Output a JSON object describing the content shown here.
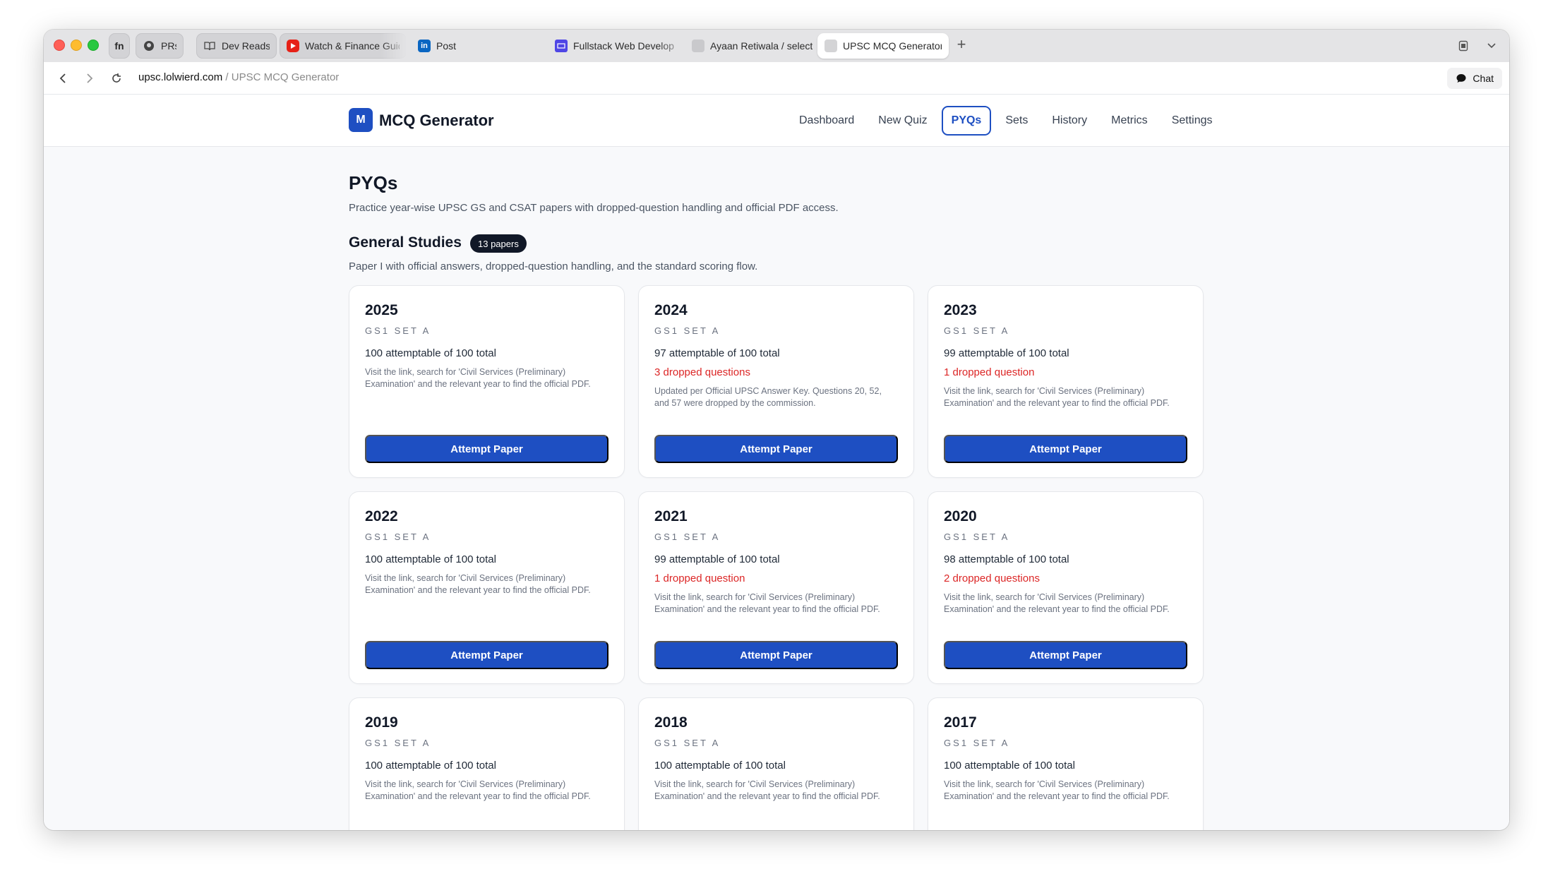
{
  "browser": {
    "tabs": [
      {
        "label": "fn",
        "icon": "fn-badge",
        "pinned": true
      },
      {
        "label": "PRs",
        "icon": "github-icon",
        "pinned": true
      },
      {
        "label": "Dev Reads",
        "icon": "book-icon",
        "pinned": true
      },
      {
        "label": "Watch & Finance Guid",
        "icon": "youtube-icon",
        "pinned": true
      },
      {
        "label": "Post",
        "icon": "linkedin-icon"
      },
      {
        "label": "Fullstack Web Develop",
        "icon": "course-icon"
      },
      {
        "label": "Ayaan Retiwala / select",
        "icon": "page-icon"
      },
      {
        "label": "UPSC MCQ Generator",
        "icon": "page-icon",
        "active": true
      }
    ],
    "url": {
      "domain": "upsc.lolwierd.com",
      "separator": " / ",
      "page": "UPSC MCQ Generator"
    },
    "chat_label": "Chat"
  },
  "app": {
    "logo_letter": "M",
    "brand": "MCQ Generator",
    "nav": [
      "Dashboard",
      "New Quiz",
      "PYQs",
      "Sets",
      "History",
      "Metrics",
      "Settings"
    ],
    "active_nav": "PYQs",
    "accent": "#1e4fc2"
  },
  "page": {
    "title": "PYQs",
    "subtitle": "Practice year-wise UPSC GS and CSAT papers with dropped-question handling and official PDF access.",
    "section": {
      "title": "General Studies",
      "badge": "13 papers",
      "subtitle": "Paper I with official answers, dropped-question handling, and the standard scoring flow."
    },
    "button_label": "Attempt Paper",
    "cards": [
      {
        "year": "2025",
        "set": "GS1 SET A",
        "count": "100 attemptable of 100 total",
        "dropped": "",
        "note": "Visit the link, search for 'Civil Services (Preliminary) Examination' and the relevant year to find the official PDF."
      },
      {
        "year": "2024",
        "set": "GS1 SET A",
        "count": "97 attemptable of 100 total",
        "dropped": "3 dropped questions",
        "note": "Updated per Official UPSC Answer Key. Questions 20, 52, and 57 were dropped by the commission."
      },
      {
        "year": "2023",
        "set": "GS1 SET A",
        "count": "99 attemptable of 100 total",
        "dropped": "1 dropped question",
        "note": "Visit the link, search for 'Civil Services (Preliminary) Examination' and the relevant year to find the official PDF."
      },
      {
        "year": "2022",
        "set": "GS1 SET A",
        "count": "100 attemptable of 100 total",
        "dropped": "",
        "note": "Visit the link, search for 'Civil Services (Preliminary) Examination' and the relevant year to find the official PDF."
      },
      {
        "year": "2021",
        "set": "GS1 SET A",
        "count": "99 attemptable of 100 total",
        "dropped": "1 dropped question",
        "note": "Visit the link, search for 'Civil Services (Preliminary) Examination' and the relevant year to find the official PDF."
      },
      {
        "year": "2020",
        "set": "GS1 SET A",
        "count": "98 attemptable of 100 total",
        "dropped": "2 dropped questions",
        "note": "Visit the link, search for 'Civil Services (Preliminary) Examination' and the relevant year to find the official PDF."
      },
      {
        "year": "2019",
        "set": "GS1 SET A",
        "count": "100 attemptable of 100 total",
        "dropped": "",
        "note": "Visit the link, search for 'Civil Services (Preliminary) Examination' and the relevant year to find the official PDF."
      },
      {
        "year": "2018",
        "set": "GS1 SET A",
        "count": "100 attemptable of 100 total",
        "dropped": "",
        "note": "Visit the link, search for 'Civil Services (Preliminary) Examination' and the relevant year to find the official PDF."
      },
      {
        "year": "2017",
        "set": "GS1 SET A",
        "count": "100 attemptable of 100 total",
        "dropped": "",
        "note": "Visit the link, search for 'Civil Services (Preliminary) Examination' and the relevant year to find the official PDF."
      }
    ]
  }
}
